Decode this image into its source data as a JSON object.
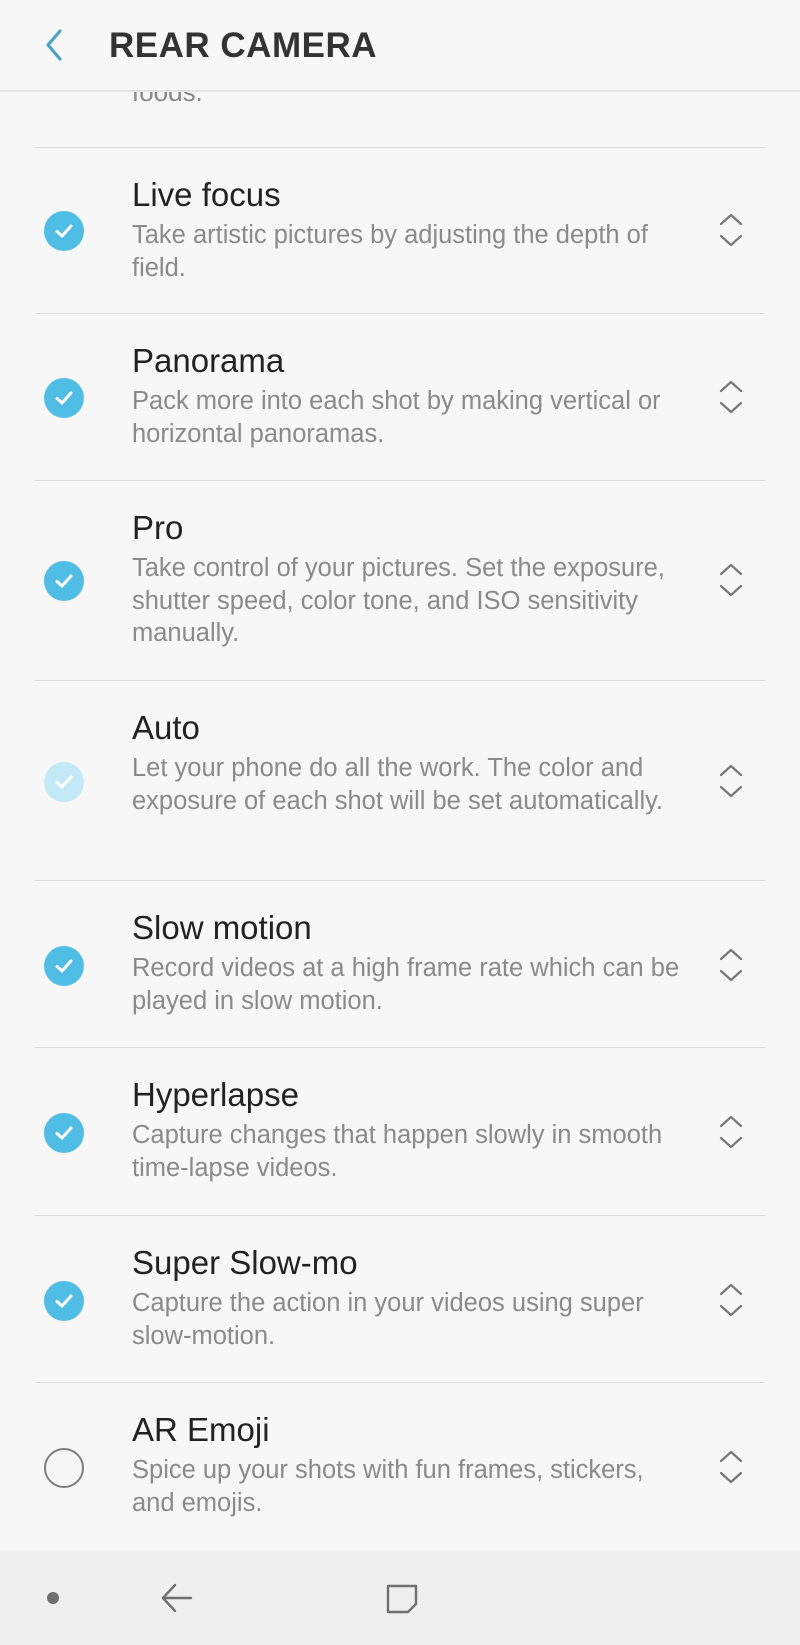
{
  "header": {
    "back_icon": "chevron-left-icon",
    "title": "REAR CAMERA"
  },
  "partial_item": {
    "description": "foods."
  },
  "modes": [
    {
      "title": "Live focus",
      "description": "Take artistic pictures by adjusting the depth of field.",
      "state": "checked"
    },
    {
      "title": "Panorama",
      "description": "Pack more into each shot by making vertical or horizontal panoramas.",
      "state": "checked"
    },
    {
      "title": "Pro",
      "description": "Take control of your pictures. Set the exposure, shutter speed, color tone, and ISO sensitivity manually.",
      "state": "checked"
    },
    {
      "title": "Auto",
      "description": "Let your phone do all the work. The color and exposure of each shot will be set automatically.",
      "state": "checked-disabled"
    },
    {
      "title": "Slow motion",
      "description": "Record videos at a high frame rate which can be played in slow motion.",
      "state": "checked"
    },
    {
      "title": "Hyperlapse",
      "description": "Capture changes that happen slowly in smooth time-lapse videos.",
      "state": "checked"
    },
    {
      "title": "Super Slow-mo",
      "description": "Capture the action in your videos using super slow-motion.",
      "state": "checked"
    },
    {
      "title": "AR Emoji",
      "description": "Spice up your shots with fun frames, stickers, and emojis.",
      "state": "unchecked"
    }
  ],
  "icons": {
    "checkbox": "check-icon",
    "reorder": "reorder-handle-icon"
  },
  "navbar": {
    "items": [
      "nav-dot-icon",
      "nav-back-icon",
      "nav-recents-icon"
    ]
  },
  "colors": {
    "accent": "#4fbde4",
    "accent_disabled": "#c4e9f6",
    "title_text": "#222222",
    "desc_text": "#8a8a8a"
  }
}
